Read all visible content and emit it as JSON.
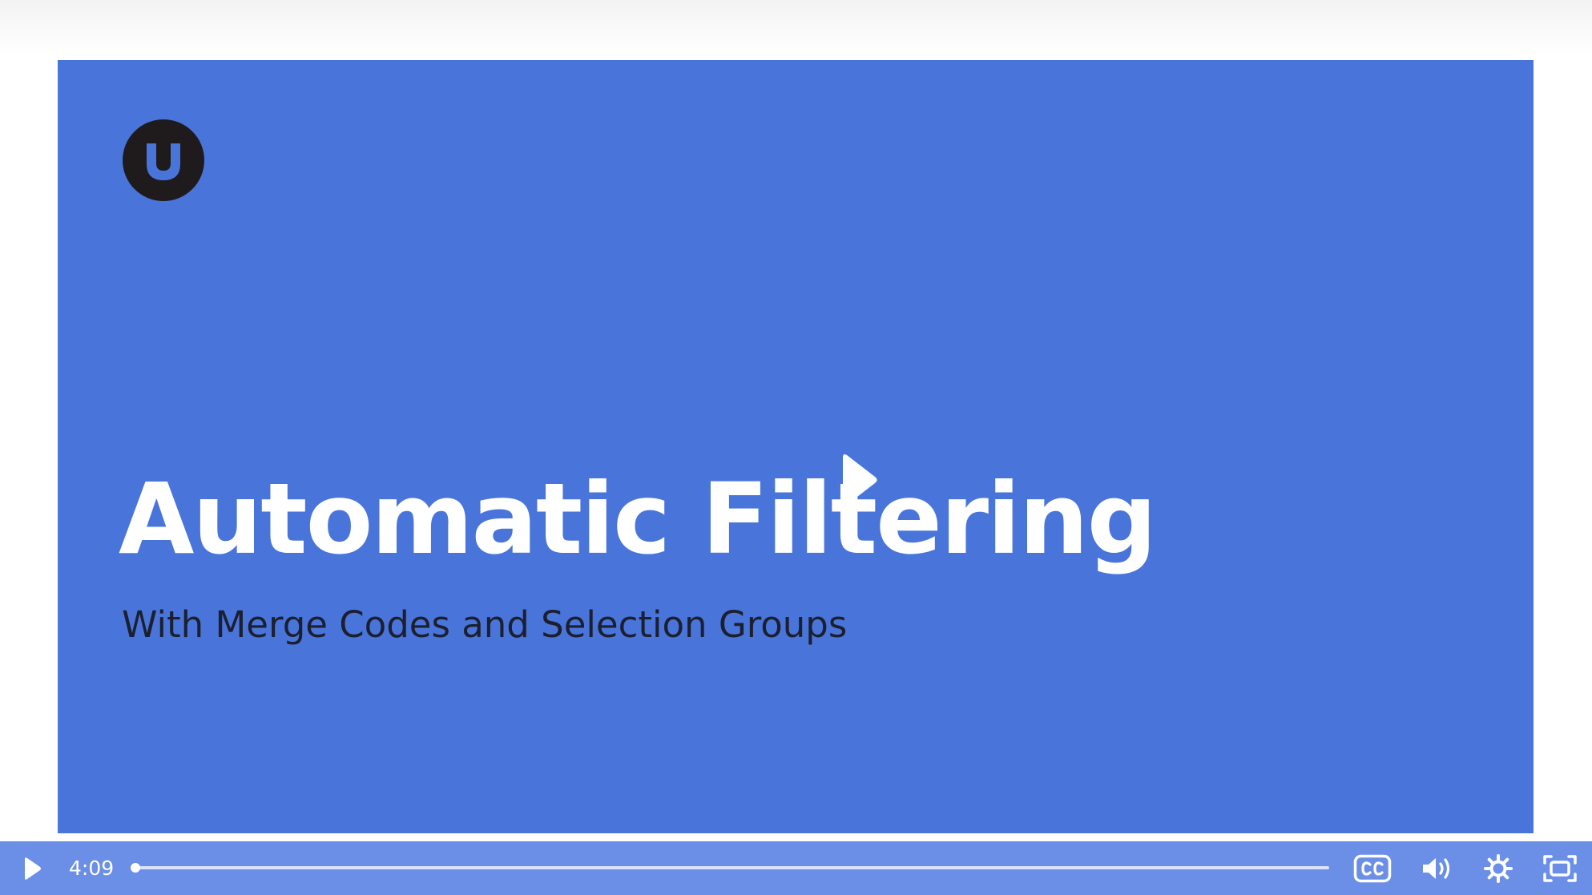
{
  "slide": {
    "title": "Automatic Filtering",
    "subtitle": "With Merge Codes and Selection Groups",
    "logo_letter": "u",
    "background_color": "#4975db"
  },
  "player": {
    "current_time": "4:09",
    "progress_fraction": 0.0,
    "controls": {
      "play": "play-icon",
      "captions": "closed-captions-icon",
      "volume": "volume-icon",
      "settings": "gear-icon",
      "fullscreen": "fullscreen-icon"
    },
    "bar_color": "#6b8fe7"
  }
}
